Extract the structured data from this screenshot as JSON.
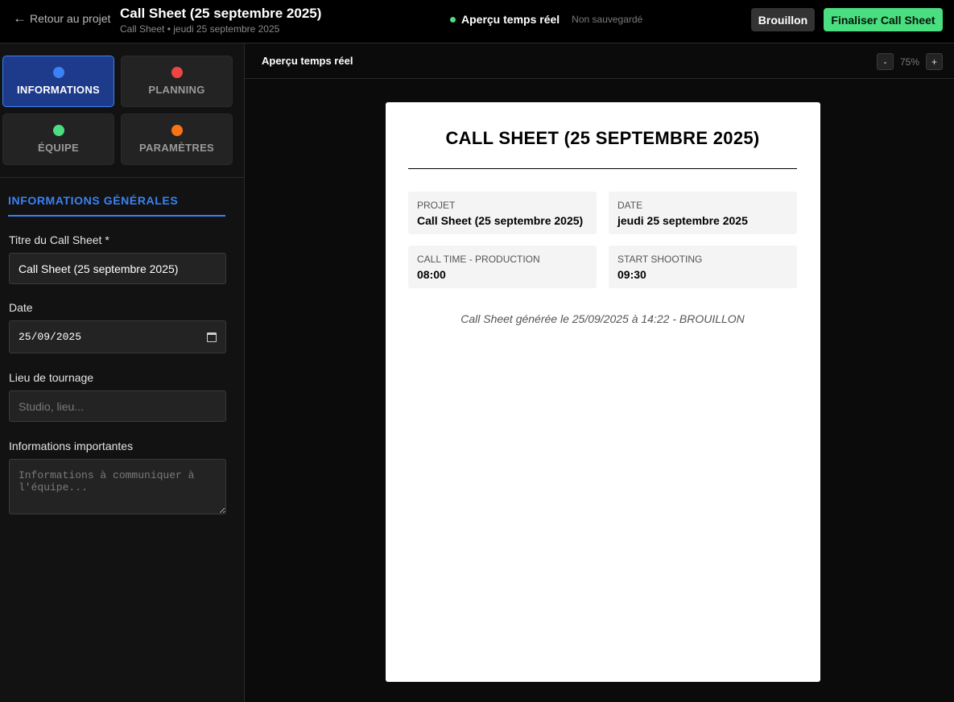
{
  "topbar": {
    "back_label": "Retour au projet",
    "title": "Call Sheet (25 septembre 2025)",
    "subtitle": "Call Sheet • jeudi 25 septembre 2025",
    "live_label": "Aperçu temps réel",
    "save_state": "Non sauvegardé",
    "draft_label": "Brouillon",
    "finalize_label": "Finaliser Call Sheet"
  },
  "colors": {
    "accent_blue": "#3b82f6",
    "accent_green": "#4ade80",
    "planning_red": "#ef4444",
    "params_orange": "#f97316"
  },
  "sidebar": {
    "tabs": [
      {
        "label": "INFORMATIONS",
        "color": "#3b82f6",
        "active": true
      },
      {
        "label": "PLANNING",
        "color": "#ef4444",
        "active": false
      },
      {
        "label": "ÉQUIPE",
        "color": "#4ade80",
        "active": false
      },
      {
        "label": "PARAMÈTRES",
        "color": "#f97316",
        "active": false
      }
    ],
    "section_title": "INFORMATIONS GÉNÉRALES",
    "fields": {
      "title": {
        "label": "Titre du Call Sheet *",
        "value": "Call Sheet (25 septembre 2025)"
      },
      "date": {
        "label": "Date",
        "value": "25/09/2025"
      },
      "location": {
        "label": "Lieu de tournage",
        "placeholder": "Studio, lieu..."
      },
      "notes": {
        "label": "Informations importantes",
        "placeholder": "Informations à communiquer à l'équipe..."
      }
    }
  },
  "preview": {
    "header_title": "Aperçu temps réel",
    "zoom_minus": "-",
    "zoom_level": "75%",
    "zoom_plus": "+",
    "sheet": {
      "title": "CALL SHEET (25 SEPTEMBRE 2025)",
      "cards": [
        {
          "label": "PROJET",
          "value": "Call Sheet (25 septembre 2025)"
        },
        {
          "label": "DATE",
          "value": "jeudi 25 septembre 2025"
        },
        {
          "label": "CALL TIME - PRODUCTION",
          "value": "08:00"
        },
        {
          "label": "START SHOOTING",
          "value": "09:30"
        }
      ],
      "footer": "Call Sheet générée le 25/09/2025 à 14:22 - BROUILLON"
    }
  }
}
